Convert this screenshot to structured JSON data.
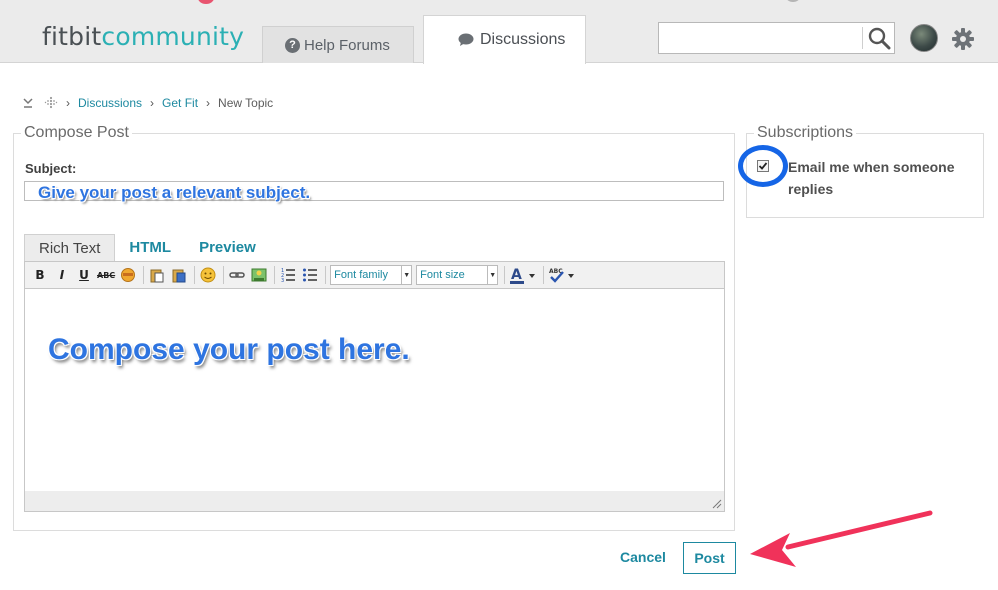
{
  "header": {
    "logo_part1": "fitbit",
    "logo_part2": "community",
    "tabs": [
      {
        "label": "Help Forums"
      },
      {
        "label": "Discussions"
      }
    ],
    "search": {
      "placeholder": ""
    }
  },
  "breadcrumb": {
    "items": [
      "Discussions",
      "Get Fit",
      "New Topic"
    ]
  },
  "compose": {
    "legend": "Compose Post",
    "subject_label": "Subject:",
    "subject_hint": "Give your post a relevant subject.",
    "editor_tabs": [
      "Rich Text",
      "HTML",
      "Preview"
    ],
    "toolbar": {
      "bold": "B",
      "italic": "I",
      "underline": "U",
      "strike": "ABC",
      "font_family": "Font family",
      "font_size": "Font size"
    },
    "editor_hint": "Compose your post here."
  },
  "subscriptions": {
    "legend": "Subscriptions",
    "email_label": "Email me when someone replies",
    "checked": true
  },
  "actions": {
    "cancel": "Cancel",
    "post": "Post"
  },
  "colors": {
    "accent": "#1d89a0",
    "annotation_blue": "#2e74e0",
    "annotation_arrow": "#f0325a"
  }
}
